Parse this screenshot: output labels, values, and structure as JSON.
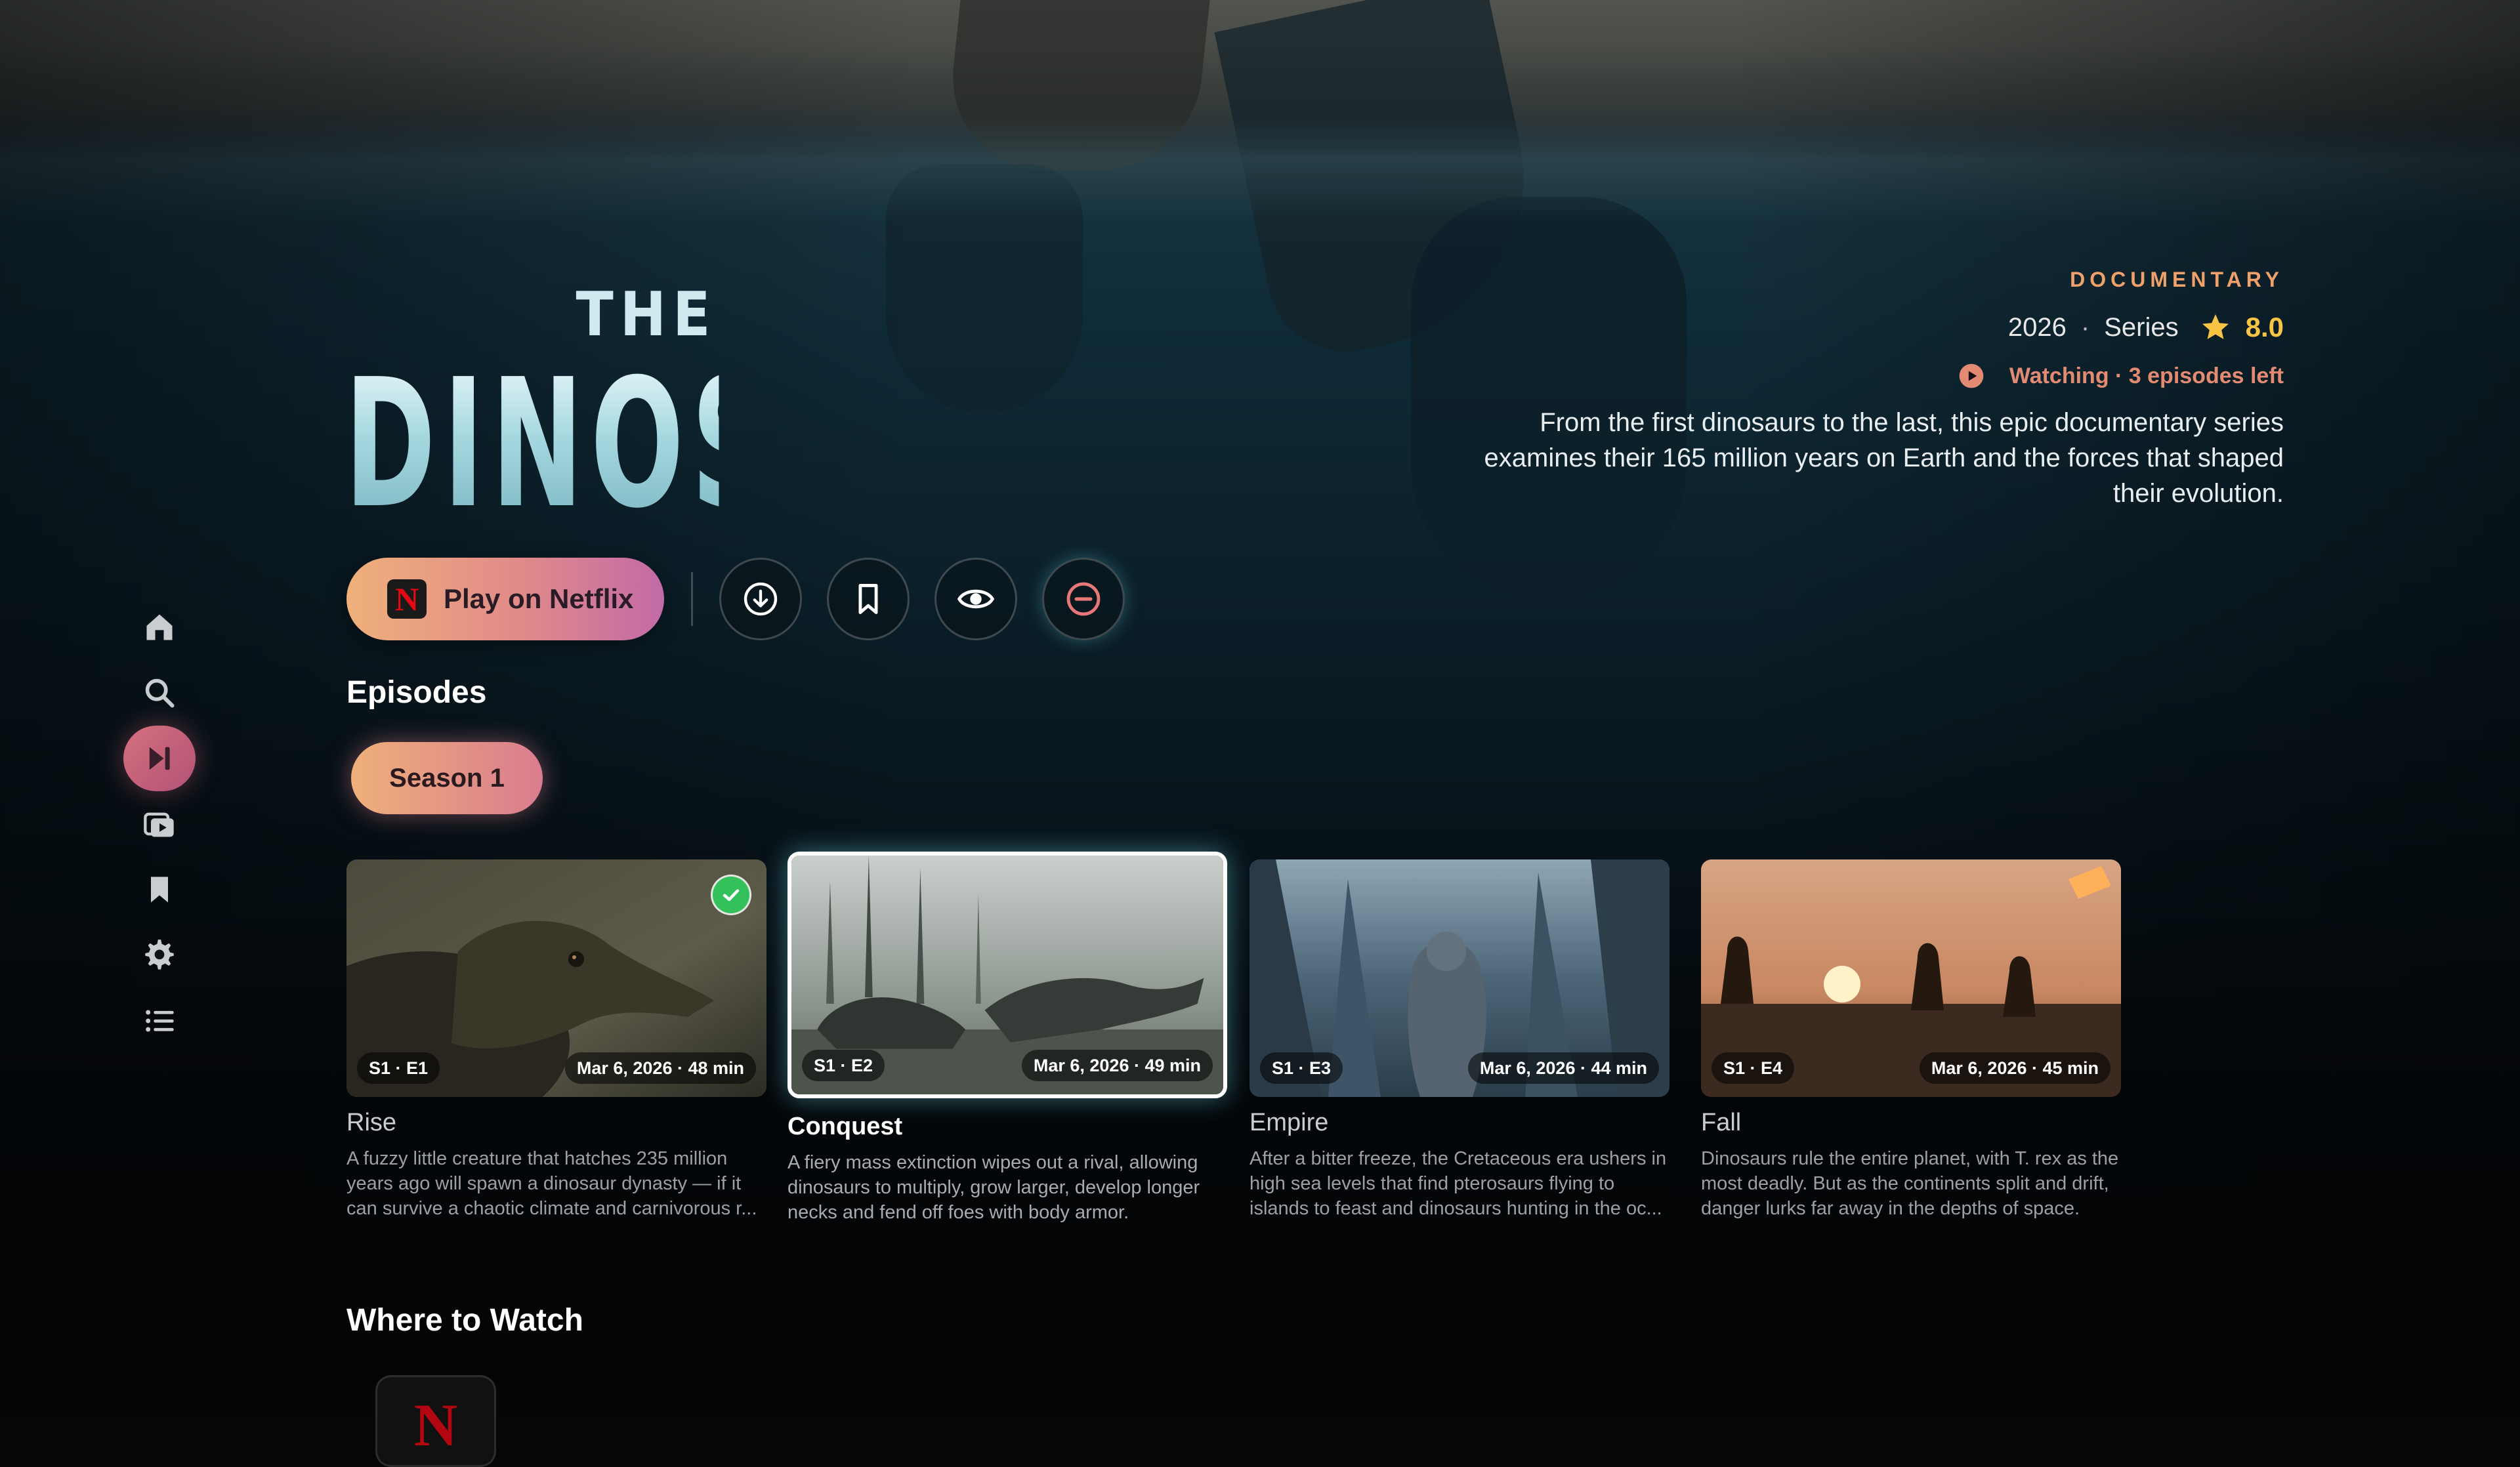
{
  "show": {
    "logo_top": "THE",
    "logo_main": "DINOSAURS",
    "genre": "DOCUMENTARY",
    "year": "2026",
    "type": "Series",
    "rating": "8.0",
    "watching": "Watching · 3 episodes left",
    "synopsis": "From the first dinosaurs to the last, this epic documentary series examines their 165 million years on Earth and the forces that shaped their evolution."
  },
  "actions": {
    "play_label": "Play on Netflix",
    "netflix_mark": "N"
  },
  "sidebar": {
    "items": [
      {
        "name": "home",
        "icon": "home-icon"
      },
      {
        "name": "search",
        "icon": "search-icon"
      },
      {
        "name": "up-next",
        "icon": "skip-forward-icon",
        "active": true
      },
      {
        "name": "library",
        "icon": "media-library-icon"
      },
      {
        "name": "watchlist",
        "icon": "bookmark-icon"
      },
      {
        "name": "settings",
        "icon": "gear-icon"
      },
      {
        "name": "lists",
        "icon": "list-icon"
      }
    ]
  },
  "episodes": {
    "title": "Episodes",
    "season": "Season 1",
    "items": [
      {
        "code": "S1 · E1",
        "date": "Mar 6, 2026 · 48 min",
        "title": "Rise",
        "watched": true,
        "desc": "A fuzzy little creature that hatches 235 million years ago will spawn a dinosaur dynasty — if it can survive a chaotic climate and carnivorous r..."
      },
      {
        "code": "S1 · E2",
        "date": "Mar 6, 2026 · 49 min",
        "title": "Conquest",
        "focused": true,
        "desc": "A fiery mass extinction wipes out a rival, allowing dinosaurs to multiply, grow larger, develop longer necks and fend off foes with body armor."
      },
      {
        "code": "S1 · E3",
        "date": "Mar 6, 2026 · 44 min",
        "title": "Empire",
        "desc": "After a bitter freeze, the Cretaceous era ushers in high sea levels that find pterosaurs flying to islands to feast and dinosaurs hunting in the oc..."
      },
      {
        "code": "S1 · E4",
        "date": "Mar 6, 2026 · 45 min",
        "title": "Fall",
        "desc": "Dinosaurs rule the entire planet, with T. rex as the most deadly. But as the continents split and drift, danger lurks far away in the depths of space."
      }
    ]
  },
  "where_to_watch": {
    "title": "Where to Watch",
    "providers": [
      {
        "mark": "N",
        "icon": "netflix-logo"
      }
    ]
  },
  "colors": {
    "accent_start": "#efb07a",
    "accent_end": "#c26aa8",
    "rating": "#f7c443",
    "watching": "#e28a72",
    "watched_check": "#32c15b"
  }
}
